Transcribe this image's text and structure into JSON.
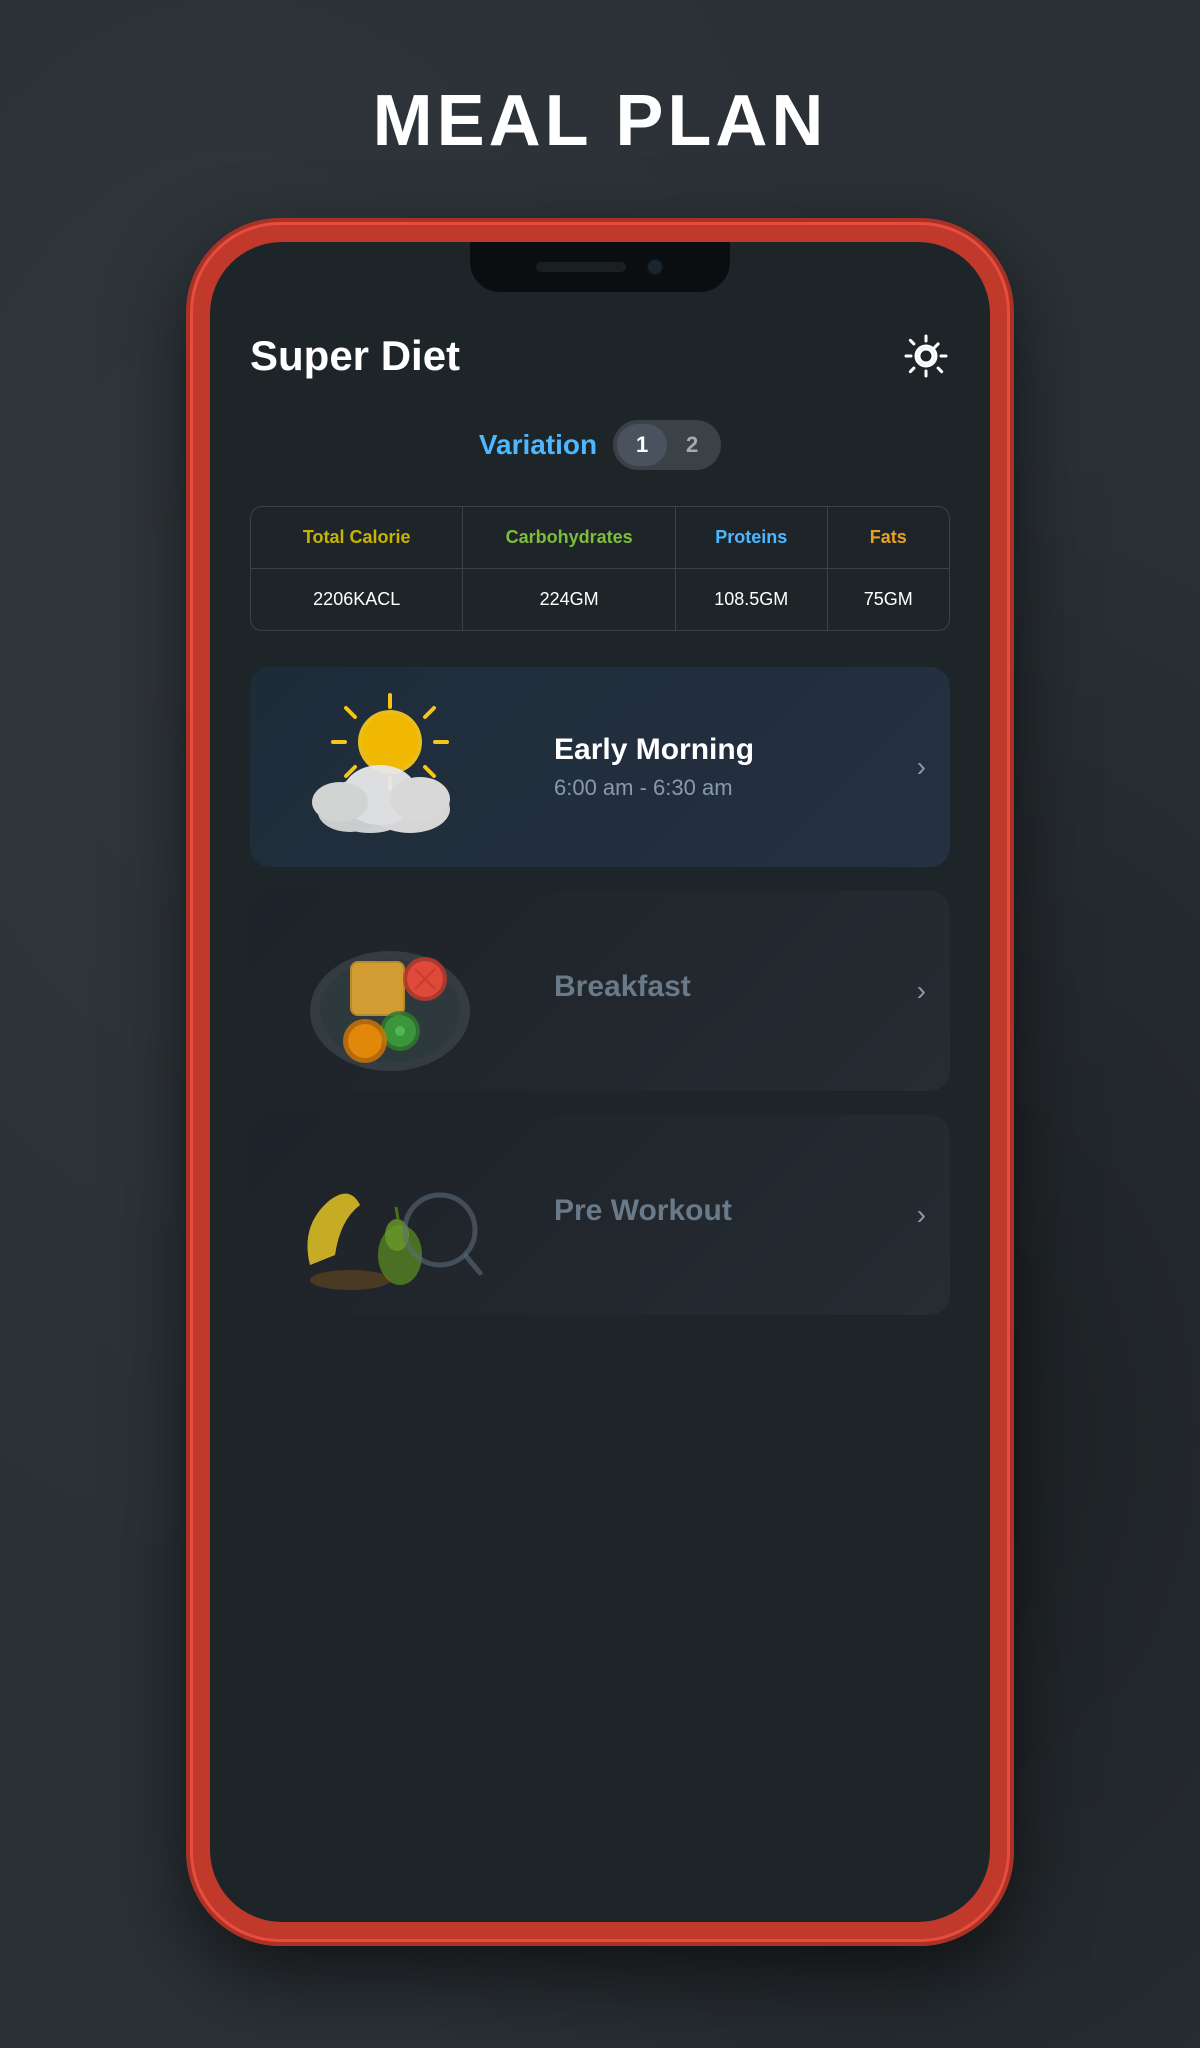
{
  "page": {
    "title": "MEAL PLAN",
    "background_color": "#2a3035"
  },
  "app": {
    "name": "Super Diet",
    "settings_icon": "⚙"
  },
  "variation": {
    "label": "Variation",
    "options": [
      "1",
      "2"
    ],
    "active": "1"
  },
  "nutrition": {
    "headers": [
      "Total Calorie",
      "Carbohydrates",
      "Proteins",
      "Fats"
    ],
    "header_colors": [
      "yellow",
      "green",
      "cyan",
      "orange"
    ],
    "values": [
      "2206KACL",
      "224GM",
      "108.5GM",
      "75GM"
    ]
  },
  "meal_cards": [
    {
      "id": "early-morning",
      "title": "Early Morning",
      "time": "6:00 am - 6:30 am",
      "title_style": "bright",
      "has_arrow": true
    },
    {
      "id": "breakfast",
      "title": "Breakfast",
      "time": "",
      "title_style": "dimmed",
      "has_arrow": true
    },
    {
      "id": "pre-workout",
      "title": "Pre Workout",
      "time": "",
      "title_style": "dimmed",
      "has_arrow": true
    }
  ]
}
